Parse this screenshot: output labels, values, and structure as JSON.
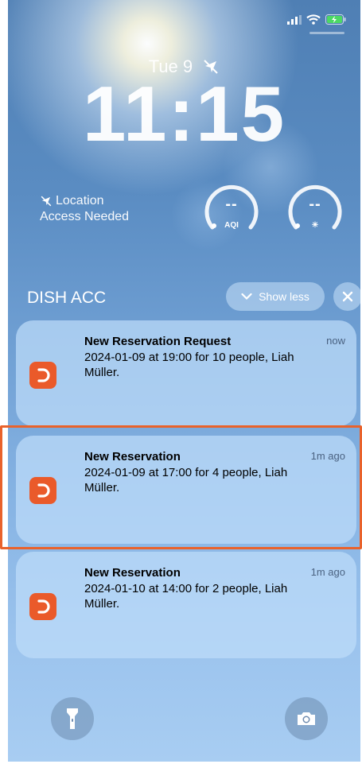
{
  "status_bar": {
    "icons": [
      "cellular-signal-icon",
      "wifi-icon",
      "battery-charging-icon"
    ],
    "battery_color": "#4cd964"
  },
  "lockscreen": {
    "date": "Tue 9",
    "clock": "11:15",
    "location_widget": {
      "line1": "Location",
      "line2": "Access Needed"
    },
    "gauges": [
      {
        "value": "--",
        "label": "AQI"
      },
      {
        "value": "--",
        "label": "☀"
      }
    ]
  },
  "notification_group": {
    "title": "DISH ACC",
    "show_less_label": "Show less"
  },
  "notifications": [
    {
      "title": "New Reservation Request",
      "body": "2024-01-09 at 19:00 for 10 people, Liah Müller.",
      "time": "now"
    },
    {
      "title": "New Reservation",
      "body": "2024-01-09 at 17:00 for 4 people, Liah Müller.",
      "time": "1m ago"
    },
    {
      "title": "New Reservation",
      "body": "2024-01-10 at 14:00 for 2 people, Liah Müller.",
      "time": "1m ago"
    }
  ],
  "colors": {
    "app_icon": "#ea5a2a",
    "highlight": "#e9622b"
  },
  "bottom_buttons": [
    "flashlight-icon",
    "camera-icon"
  ]
}
